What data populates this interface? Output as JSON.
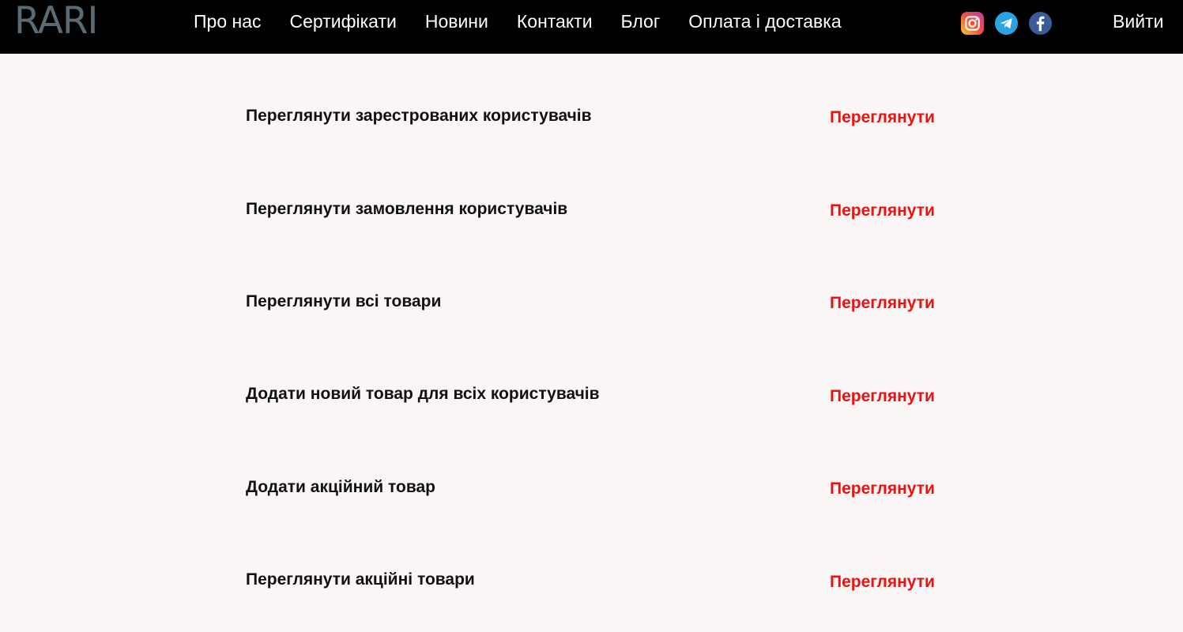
{
  "header": {
    "logo": "RARI",
    "nav": [
      {
        "label": "Про нас"
      },
      {
        "label": "Сертифікати"
      },
      {
        "label": "Новини"
      },
      {
        "label": "Контакти"
      },
      {
        "label": "Блог"
      },
      {
        "label": "Оплата і доставка"
      }
    ],
    "social_icons": [
      "instagram-icon",
      "telegram-icon",
      "facebook-icon"
    ],
    "logout": "Вийти"
  },
  "rows": [
    {
      "label": "Переглянути зарестрованих користувачів",
      "action": "Переглянути"
    },
    {
      "label": "Переглянути замовлення користувачів",
      "action": "Переглянути"
    },
    {
      "label": "Переглянути всі товари",
      "action": "Переглянути"
    },
    {
      "label": "Додати новий товар для всіх користувачів",
      "action": "Переглянути"
    },
    {
      "label": "Додати акційний товар",
      "action": "Переглянути"
    },
    {
      "label": "Переглянути акційні товари",
      "action": "Переглянути"
    }
  ],
  "colors": {
    "header_bg": "#000000",
    "page_bg": "#f9f6f5",
    "logo": "#5a6b76",
    "action": "#ee1111"
  }
}
